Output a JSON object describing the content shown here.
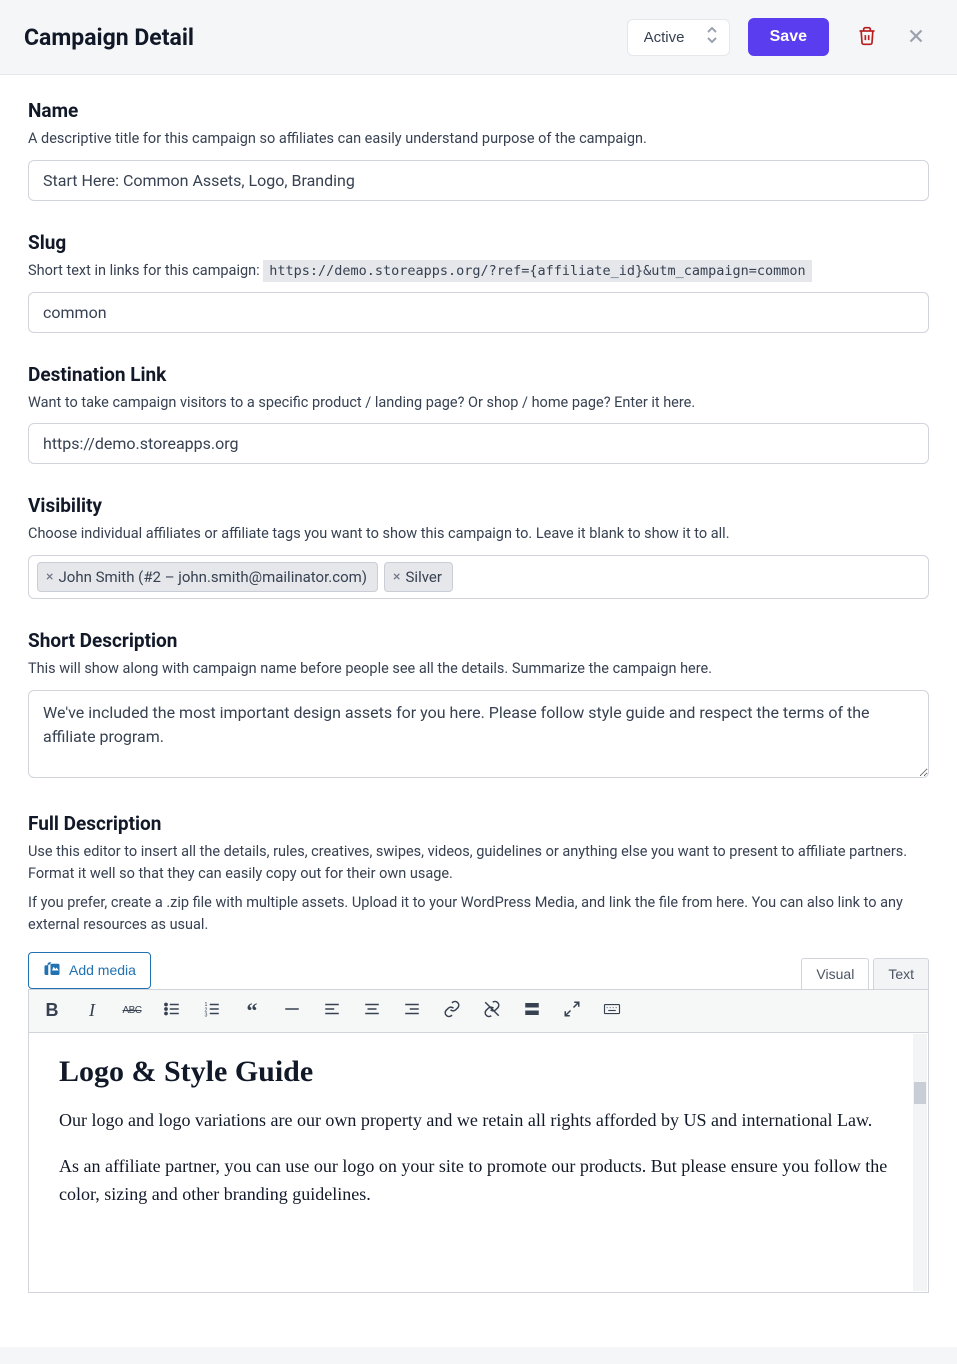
{
  "header": {
    "title": "Campaign Detail",
    "status": "Active",
    "save_label": "Save"
  },
  "name": {
    "label": "Name",
    "help": "A descriptive title for this campaign so affiliates can easily understand purpose of the campaign.",
    "value": "Start Here: Common Assets, Logo, Branding"
  },
  "slug": {
    "label": "Slug",
    "help_prefix": "Short text in links for this campaign: ",
    "url_sample": "https://demo.storeapps.org/?ref={affiliate_id}&utm_campaign=common",
    "value": "common"
  },
  "destination": {
    "label": "Destination Link",
    "help": "Want to take campaign visitors to a specific product / landing page? Or shop / home page? Enter it here.",
    "value": "https://demo.storeapps.org"
  },
  "visibility": {
    "label": "Visibility",
    "help": "Choose individual affiliates or affiliate tags you want to show this campaign to. Leave it blank to show it to all.",
    "tags": [
      "John Smith (#2 – john.smith@mailinator.com)",
      "Silver"
    ]
  },
  "short_desc": {
    "label": "Short Description",
    "help": "This will show along with campaign name before people see all the details. Summarize the campaign here.",
    "value": "We've included the most important design assets for you here. Please follow style guide and respect the terms of the affiliate program."
  },
  "full_desc": {
    "label": "Full Description",
    "help1": "Use this editor to insert all the details, rules, creatives, swipes, videos, guidelines or anything else you want to present to affiliate partners. Format it well so that they can easily copy out for their own usage.",
    "help2": "If you prefer, create a .zip file with multiple assets. Upload it to your WordPress Media, and link the file from here. You can also link to any external resources as usual.",
    "add_media_label": "Add media",
    "tabs": {
      "visual": "Visual",
      "text": "Text"
    },
    "content_heading": "Logo & Style Guide",
    "content_p1": "Our logo and logo variations are our own property and we retain all rights afforded by US and international Law.",
    "content_p2": "As an affiliate partner, you can use our logo on your site to promote our products. But please ensure you follow the color, sizing and other branding guidelines."
  }
}
